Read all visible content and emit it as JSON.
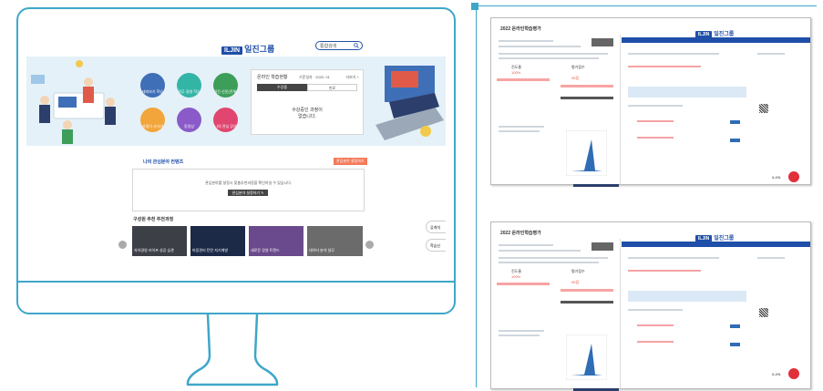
{
  "colors": {
    "frame": "#3ea7c9",
    "brand": "#1f4fa8",
    "hero_bg": "#e5f1f8"
  },
  "monitor_screen": {
    "logo_mark": "ILJIN",
    "logo_text": "일진그룹",
    "search_placeholder": "통합검색",
    "search_icon": "magnifier-icon",
    "menu_icons": [
      {
        "label": "테마보기 학습",
        "color": "#3f6fb6"
      },
      {
        "label": "직무·경영 학습",
        "color": "#33b5a6"
      },
      {
        "label": "일진 신문(전체)",
        "color": "#3d9e5a"
      },
      {
        "label": "과정이 사다리",
        "color": "#f2a53a"
      },
      {
        "label": "동영상",
        "color": "#8a5bc8"
      },
      {
        "label": "나의 관심 강의",
        "color": "#e0466f"
      }
    ],
    "status_panel": {
      "title": "온라인 학습현황",
      "subtitle": "기준일자 · 2020. 01",
      "more": "더보기 +",
      "tab_active": "수강중",
      "tab_inactive": "완료",
      "empty_line1": "수강중인 과정이",
      "empty_line2": "없습니다."
    },
    "interest": {
      "title": "나의 관심분야 컨텐츠",
      "badge": "관심분야 설정하기",
      "msg": "관심분야를 설정시 맞춤추천과정을 확인하실 수 있습니다.",
      "button": "관심분야 설정하기 ✎"
    },
    "recommend": {
      "title": "구성원 추천 주천과정",
      "thumbs": [
        {
          "caption": "자아경영 라이프 성공 습관",
          "bg": "#3d3f47"
        },
        {
          "caption": "마음관리 탄탄 자기계발",
          "bg": "#1c2a48"
        },
        {
          "caption": "새로운 경영 트렌드",
          "bg": "#6a4a8c"
        },
        {
          "caption": "데이터 분석 실무",
          "bg": "#6b6b6b"
        }
      ],
      "side_btn1": "공개석",
      "side_btn2": "학습신"
    }
  },
  "doc_top": {
    "title": "2022 온라인학습평가",
    "logo_mark": "ILJIN",
    "logo_text": "일진그룹",
    "score_label": "진도율",
    "score_value": "100%",
    "result_label": "평가점수",
    "result_value": "95점",
    "footer": "ILJIN"
  },
  "doc_bottom": {
    "title": "2022 온라인학습평가",
    "logo_mark": "ILJIN",
    "logo_text": "일진그룹",
    "score_label": "진도율",
    "score_value": "100%",
    "result_label": "평가점수",
    "result_value": "95점",
    "footer": "ILJIN"
  }
}
